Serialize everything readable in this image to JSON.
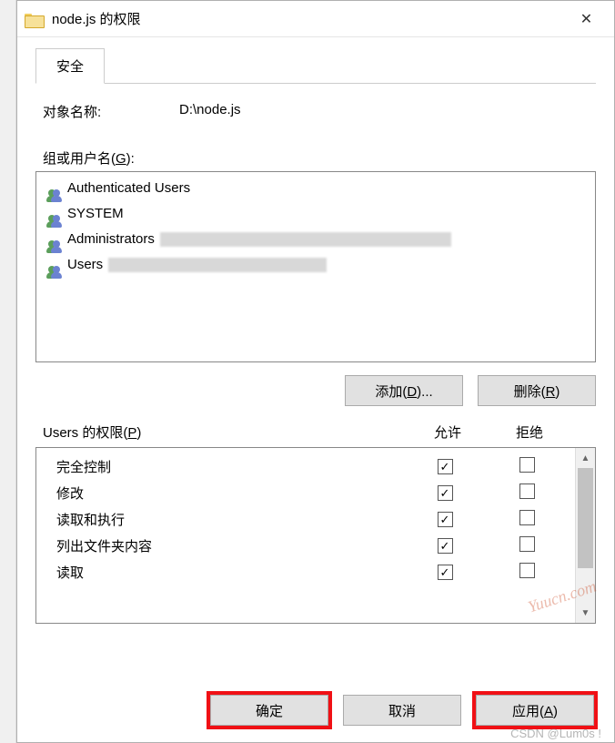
{
  "window": {
    "title": "node.js 的权限"
  },
  "tabs": {
    "security": "安全"
  },
  "object": {
    "label": "对象名称:",
    "value": "D:\\node.js"
  },
  "groups": {
    "label_pre": "组或用户名(",
    "label_key": "G",
    "label_post": "):",
    "items": [
      {
        "name": "Authenticated Users",
        "extra_blur_width": 0
      },
      {
        "name": "SYSTEM",
        "extra_blur_width": 0
      },
      {
        "name": "Administrators",
        "extra_blur_width": 320
      },
      {
        "name": "Users",
        "extra_blur_width": 240
      }
    ]
  },
  "buttons": {
    "add_pre": "添加(",
    "add_key": "D",
    "add_post": ")...",
    "remove_pre": "删除(",
    "remove_key": "R",
    "remove_post": ")",
    "ok": "确定",
    "cancel": "取消",
    "apply_pre": "应用(",
    "apply_key": "A",
    "apply_post": ")"
  },
  "permissions": {
    "title_pre": "Users 的权限(",
    "title_key": "P",
    "title_post": ")",
    "allow": "允许",
    "deny": "拒绝",
    "rows": [
      {
        "name": "完全控制",
        "allow": true,
        "deny": false
      },
      {
        "name": "修改",
        "allow": true,
        "deny": false
      },
      {
        "name": "读取和执行",
        "allow": true,
        "deny": false
      },
      {
        "name": "列出文件夹内容",
        "allow": true,
        "deny": false
      },
      {
        "name": "读取",
        "allow": true,
        "deny": false
      }
    ]
  },
  "watermarks": {
    "w1": "Yuucn.com",
    "w2": "CSDN @Lum0s !"
  }
}
